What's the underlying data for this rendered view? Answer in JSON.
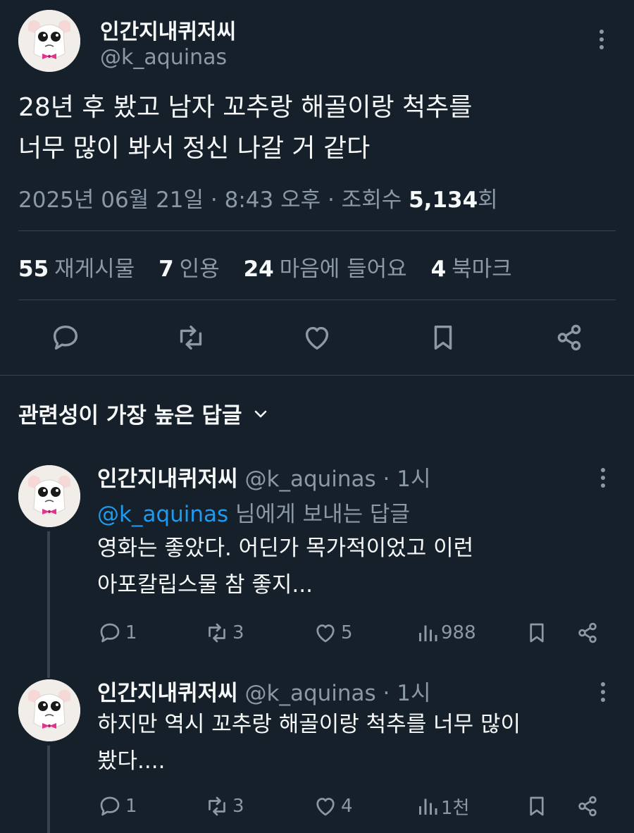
{
  "tweet": {
    "author_name": "인간지내퀴저씨",
    "author_handle": "@k_aquinas",
    "text_line1": "28년 후 봤고 남자 꼬추랑 해골이랑 척추를",
    "text_line2": "너무 많이 봐서 정신 나갈 거 같다",
    "meta_datetime": "2025년 06월 21일 · 8:43 오후 · 조회수 ",
    "views": "5,134",
    "views_suffix": "회",
    "stats": {
      "reposts": {
        "count": "55",
        "label": "재게시물"
      },
      "quotes": {
        "count": "7",
        "label": "인용"
      },
      "likes": {
        "count": "24",
        "label": "마음에 들어요"
      },
      "bookmarks": {
        "count": "4",
        "label": "북마크"
      }
    }
  },
  "replies_sort_label": "관련성이 가장 높은 답글",
  "replies": [
    {
      "name": "인간지내퀴저씨",
      "handle": "@k_aquinas",
      "separator": " · ",
      "time": "1시",
      "reply_to_mention": "@k_aquinas",
      "reply_to_suffix": " 님에게 보내는 답글",
      "line1": "영화는 좋았다. 어딘가 목가적이었고 이런",
      "line2": "아포칼립스물 참 좋지...",
      "counts": {
        "replies": "1",
        "reposts": "3",
        "likes": "5",
        "views": "988"
      }
    },
    {
      "name": "인간지내퀴저씨",
      "handle": "@k_aquinas",
      "separator": " · ",
      "time": "1시",
      "line1": "하지만 역시 꼬추랑 해골이랑 척추를 너무 많이",
      "line2": "봤다....",
      "counts": {
        "replies": "1",
        "reposts": "3",
        "likes": "4",
        "views": "1천"
      }
    }
  ],
  "icons": {
    "reply": "speech-bubble-icon",
    "repost": "repost-arrows-icon",
    "like": "heart-icon",
    "bookmark": "bookmark-icon",
    "share": "share-icon",
    "views": "bar-chart-icon",
    "more": "three-dots-vertical-icon",
    "sort": "chevron-down-icon"
  },
  "colors": {
    "background": "#15202b",
    "primary_text": "#f7f9f9",
    "secondary_text": "#8b98a5",
    "link": "#1d9bf0",
    "divider": "#38444d"
  }
}
